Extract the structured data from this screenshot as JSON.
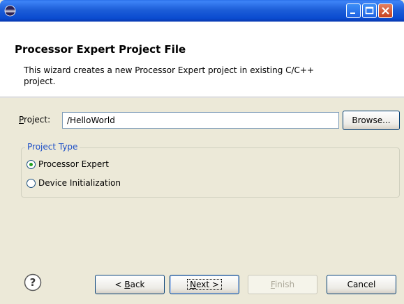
{
  "window": {
    "title": "",
    "app_icon": "eclipse-icon",
    "controls": [
      "minimize-icon",
      "maximize-icon",
      "close-icon"
    ]
  },
  "header": {
    "title": "Processor Expert Project File",
    "description": "This wizard creates a new Processor Expert project in existing C/C++ project."
  },
  "project": {
    "label": "Project:",
    "value": "/HelloWorld",
    "browse_label": "Browse..."
  },
  "project_type": {
    "legend": "Project Type",
    "options": [
      {
        "label": "Processor Expert",
        "checked": true
      },
      {
        "label": "Device Initialization",
        "checked": false
      }
    ]
  },
  "buttons": {
    "help_icon": "question-icon",
    "back": "< Back",
    "next": "Next >",
    "finish": "Finish",
    "cancel": "Cancel"
  },
  "colors": {
    "title_bar": "#0a4bd0",
    "dialog_bg": "#ece9d8",
    "legend_text": "#1d4fc7",
    "radio_dot": "#21a121"
  }
}
